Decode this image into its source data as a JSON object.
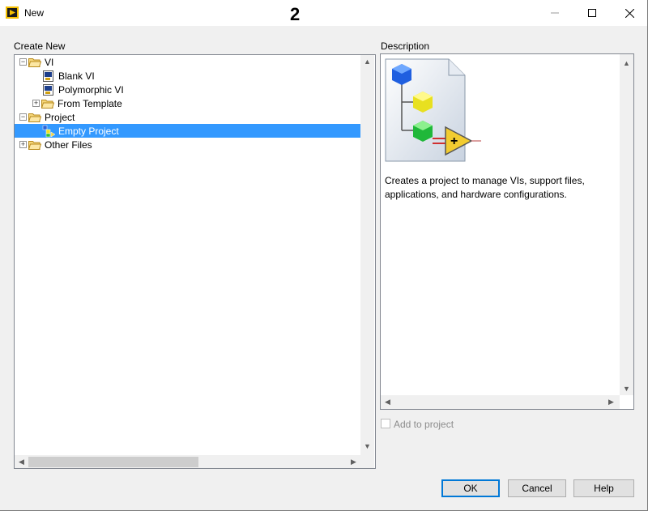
{
  "window": {
    "title": "New",
    "step_number": "2"
  },
  "window_controls": {
    "minimize": "—",
    "maximize": "☐",
    "close": "✕"
  },
  "create_new": {
    "label": "Create New",
    "tree": [
      {
        "label": "VI",
        "type": "folder",
        "level": 0,
        "expander": "−"
      },
      {
        "label": "Blank VI",
        "type": "vi",
        "level": 1
      },
      {
        "label": "Polymorphic VI",
        "type": "vi",
        "level": 1
      },
      {
        "label": "From Template",
        "type": "folder",
        "level": 1,
        "expander": "+"
      },
      {
        "label": "Project",
        "type": "folder",
        "level": 0,
        "expander": "−"
      },
      {
        "label": "Empty Project",
        "type": "project",
        "level": 1,
        "selected": true
      },
      {
        "label": "Other Files",
        "type": "folder",
        "level": 0,
        "expander": "+"
      }
    ]
  },
  "description": {
    "label": "Description",
    "text": "Creates a project to manage VIs, support files, applications, and hardware configurations."
  },
  "add_to_project": {
    "label": "Add to project",
    "checked": false,
    "enabled": false
  },
  "buttons": {
    "ok": "OK",
    "cancel": "Cancel",
    "help": "Help"
  },
  "colors": {
    "selection": "#3399ff",
    "default_button_border": "#0078d7"
  }
}
